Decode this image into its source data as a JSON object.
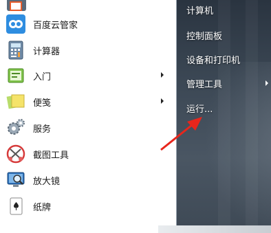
{
  "left_menu": {
    "items": [
      {
        "label": "百度云管家",
        "icon": "baidu-cloud-icon",
        "has_submenu": false
      },
      {
        "label": "计算器",
        "icon": "calculator-icon",
        "has_submenu": false
      },
      {
        "label": "入门",
        "icon": "getting-started-icon",
        "has_submenu": true
      },
      {
        "label": "便笺",
        "icon": "sticky-notes-icon",
        "has_submenu": true
      },
      {
        "label": "服务",
        "icon": "services-gear-icon",
        "has_submenu": false
      },
      {
        "label": "截图工具",
        "icon": "snipping-tool-icon",
        "has_submenu": false
      },
      {
        "label": "放大镜",
        "icon": "magnifier-icon",
        "has_submenu": false
      },
      {
        "label": "纸牌",
        "icon": "solitaire-icon",
        "has_submenu": false
      }
    ]
  },
  "right_menu": {
    "items": [
      {
        "label": "计算机",
        "has_submenu": false
      },
      {
        "label": "控制面板",
        "has_submenu": false
      },
      {
        "label": "设备和打印机",
        "has_submenu": false
      },
      {
        "label": "管理工具",
        "has_submenu": true
      },
      {
        "label": "运行...",
        "has_submenu": false
      }
    ]
  },
  "colors": {
    "right_pane": "#3b4754",
    "annotation_arrow": "#e8261c"
  }
}
